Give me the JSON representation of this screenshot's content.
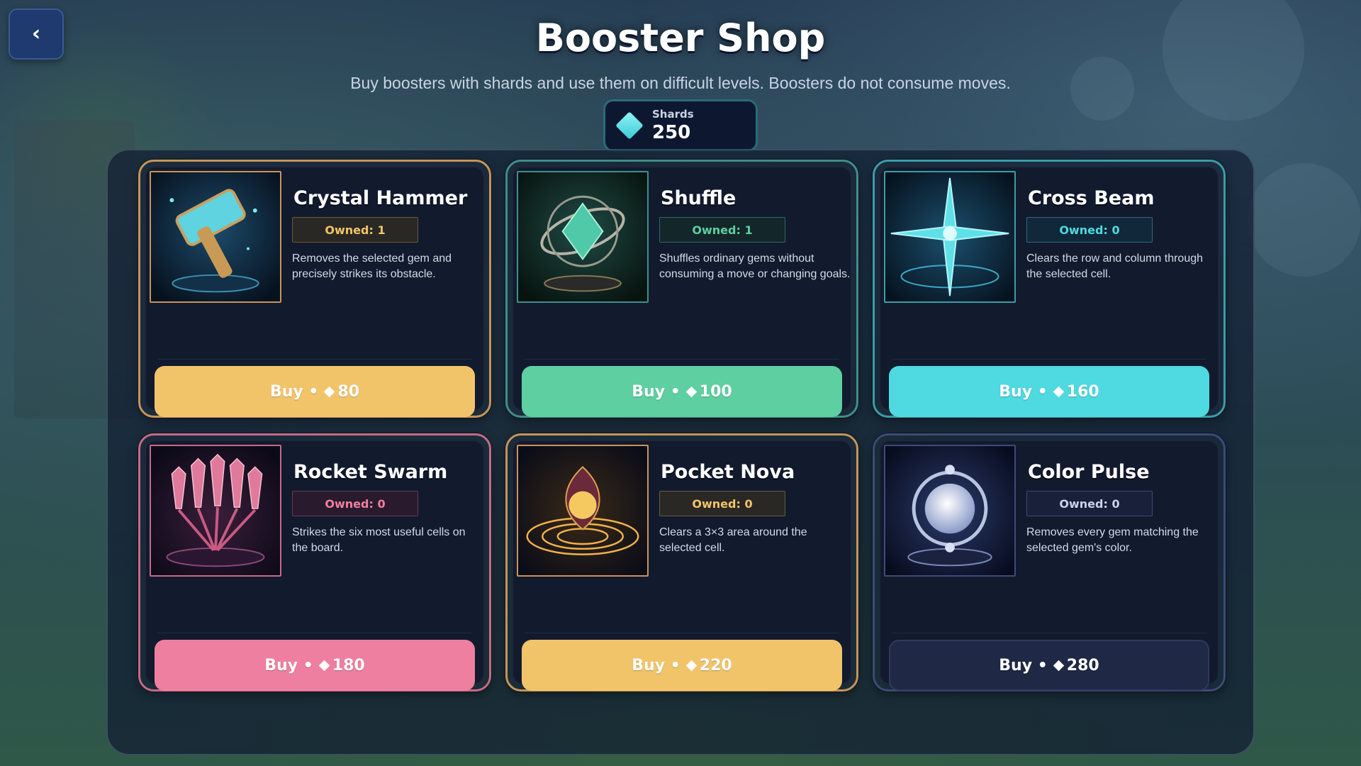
{
  "header": {
    "back_icon": "chevron-left-icon",
    "title": "Booster Shop",
    "subtitle": "Buy boosters with shards and use them on difficult levels. Boosters do not consume moves."
  },
  "shards": {
    "label": "Shards",
    "value": "250",
    "icon": "diamond-gem-icon",
    "color": "#5fe0e6"
  },
  "boosters": [
    {
      "name": "Crystal Hammer",
      "owned": "Owned: 1",
      "description": "Removes the selected gem and precisely strikes its obstacle.",
      "buy_label": "Buy •",
      "price": "80",
      "icon": "hammer-icon",
      "accent": "#f2c46a",
      "border": "#c8945a",
      "badge_text": "#f2c46a",
      "badge_bg": "#2a2824",
      "badge_border": "#6a5a3a",
      "button_bg": "#f2c46a"
    },
    {
      "name": "Shuffle",
      "owned": "Owned: 1",
      "description": "Shuffles ordinary gems without consuming a move or changing goals.",
      "buy_label": "Buy •",
      "price": "100",
      "icon": "armillary-sphere-icon",
      "accent": "#5ecfa0",
      "border": "#3f8f8a",
      "badge_text": "#5ecfa0",
      "badge_bg": "#13262a",
      "badge_border": "#2f6a60",
      "button_bg": "#5ecfa0"
    },
    {
      "name": "Cross Beam",
      "owned": "Owned: 0",
      "description": "Clears the row and column through the selected cell.",
      "buy_label": "Buy •",
      "price": "160",
      "icon": "cross-crystal-icon",
      "accent": "#4fd9e0",
      "border": "#3a9ea6",
      "badge_text": "#4fd9e0",
      "badge_bg": "#10283a",
      "badge_border": "#2f6a78",
      "button_bg": "#4fd9e0"
    },
    {
      "name": "Rocket Swarm",
      "owned": "Owned: 0",
      "description": "Strikes the six most useful cells on the board.",
      "buy_label": "Buy •",
      "price": "180",
      "icon": "rocket-crystals-icon",
      "accent": "#ef7fa0",
      "border": "#c66a86",
      "badge_text": "#ef7fa0",
      "badge_bg": "#2a1a2e",
      "badge_border": "#6a3a52",
      "button_bg": "#ef7fa0"
    },
    {
      "name": "Pocket Nova",
      "owned": "Owned: 0",
      "description": "Clears a 3×3 area around the selected cell.",
      "buy_label": "Buy •",
      "price": "220",
      "icon": "nova-flower-icon",
      "accent": "#f2c46a",
      "border": "#c8945a",
      "badge_text": "#f2c46a",
      "badge_bg": "#2a2824",
      "badge_border": "#6a5a3a",
      "button_bg": "#f2c46a"
    },
    {
      "name": "Color Pulse",
      "owned": "Owned: 0",
      "description": "Removes every gem matching the selected gem's color.",
      "buy_label": "Buy •",
      "price": "280",
      "icon": "pulse-orb-icon",
      "accent": "#c9d3ea",
      "border": "#3e4a7a",
      "badge_text": "#c9d3ea",
      "badge_bg": "#18203a",
      "badge_border": "#3e4a72",
      "button_bg": "#1f2844"
    }
  ]
}
